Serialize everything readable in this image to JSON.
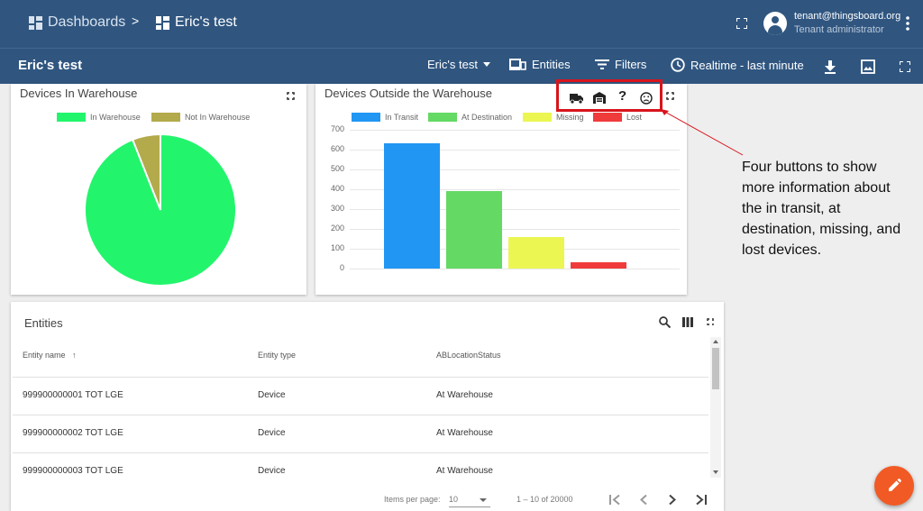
{
  "topbar": {
    "breadcrumb_root": "Dashboards",
    "separator": ">",
    "breadcrumb_current": "Eric's test",
    "user_email": "tenant@thingsboard.org",
    "user_role": "Tenant administrator"
  },
  "dashbar": {
    "title": "Eric's test",
    "state_label": "Eric's test",
    "entities_label": "Entities",
    "filters_label": "Filters",
    "timewindow_label": "Realtime - last minute"
  },
  "warehouse_card": {
    "title": "Devices In Warehouse",
    "legend": [
      "In Warehouse",
      "Not In Warehouse"
    ]
  },
  "outside_card": {
    "title": "Devices Outside the Warehouse",
    "action_icons": [
      "truck-icon",
      "warehouse-icon",
      "help-icon",
      "sad-face-icon"
    ],
    "help_glyph": "?"
  },
  "chart_data": [
    {
      "type": "pie",
      "title": "Devices In Warehouse",
      "labels": [
        "In Warehouse",
        "Not In Warehouse"
      ],
      "values": [
        94,
        6
      ],
      "colors": [
        "#22f56c",
        "#b3aa4b"
      ]
    },
    {
      "type": "bar",
      "title": "Devices Outside the Warehouse",
      "categories": [
        "In Transit",
        "At Destination",
        "Missing",
        "Lost"
      ],
      "values": [
        630,
        390,
        160,
        30
      ],
      "colors": [
        "#2196f3",
        "#64d964",
        "#ebf652",
        "#f03b3b"
      ],
      "yticks": [
        "0",
        "100",
        "200",
        "300",
        "400",
        "500",
        "600",
        "700"
      ],
      "ylim": [
        0,
        700
      ],
      "legend_placement": "top",
      "grid": true
    }
  ],
  "annotation": {
    "text": "Four buttons to show more information about the in transit, at destination, missing, and lost devices.",
    "box_color": "#d8141c"
  },
  "entities_card": {
    "title": "Entities",
    "columns": [
      "Entity name",
      "Entity type",
      "ABLocationStatus"
    ],
    "sort_arrow": "↑",
    "rows": [
      [
        "999900000001 TOT LGE",
        "Device",
        "At Warehouse"
      ],
      [
        "999900000002 TOT LGE",
        "Device",
        "At Warehouse"
      ],
      [
        "999900000003 TOT LGE",
        "Device",
        "At Warehouse"
      ]
    ],
    "items_per_page_label": "Items per page:",
    "items_per_page_value": "10",
    "range_label": "1 – 10 of 20000"
  },
  "colors": {
    "header": "#305680",
    "accent_fab": "#f15a24"
  }
}
